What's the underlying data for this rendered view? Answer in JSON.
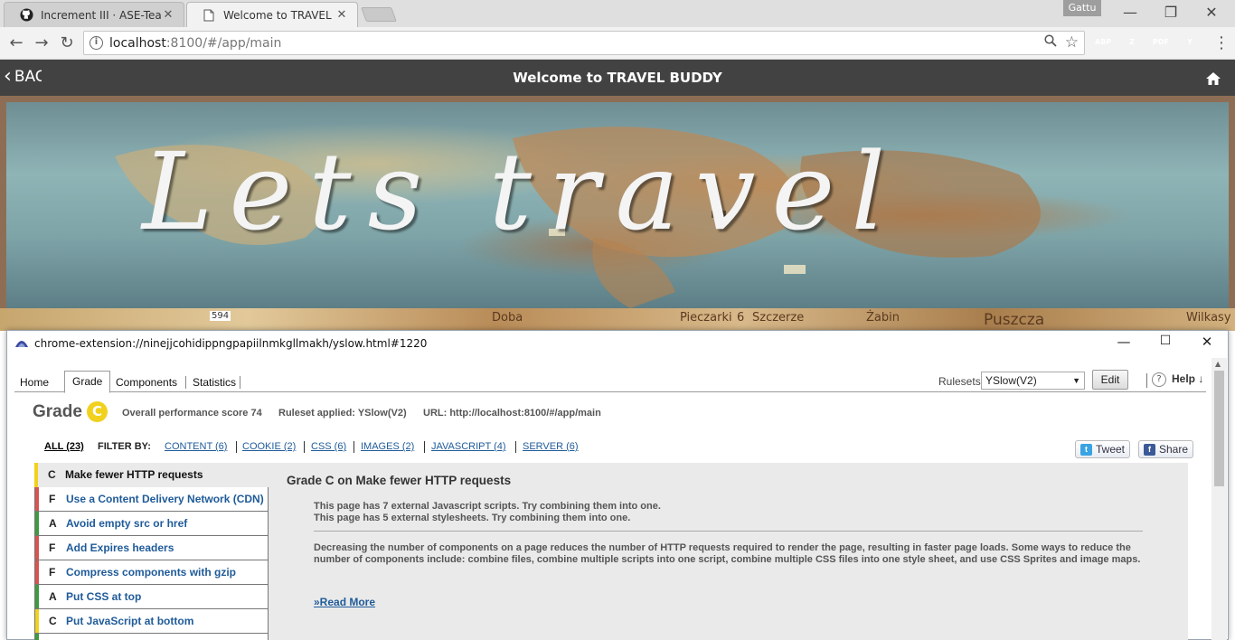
{
  "browser": {
    "tabs": [
      {
        "title": "Increment III · ASE-Team",
        "icon": "github-icon"
      },
      {
        "title": "Welcome to TRAVEL BUD",
        "icon": "page-icon"
      }
    ],
    "profile": "Gattu",
    "url_host": "localhost",
    "url_path": ":8100/#/app/main",
    "extensions": [
      {
        "name": "adblock-plus-icon",
        "label": "ABP",
        "color": "#c70d0d"
      },
      {
        "name": "zotero-icon",
        "label": "Z",
        "color": "#2a5db0"
      },
      {
        "name": "acrobat-icon",
        "label": "PDF",
        "color": "#b30b00"
      },
      {
        "name": "yslow-icon",
        "label": "Y",
        "color": "#3b4aa0"
      }
    ]
  },
  "app": {
    "back_label": "BACK",
    "title": "Welcome to TRAVEL BUDDY",
    "banner_text": "Lets travel",
    "map_labels": [
      "594",
      "Doba",
      "Pieczarki",
      "6",
      "Szczerze",
      "Żabin",
      "Puszcza",
      "Wilkasy"
    ]
  },
  "yslow": {
    "window_title": "chrome-extension://ninejjcohidippngpapiilnmkgllmakh/yslow.html#1220",
    "tabs": [
      "Home",
      "Grade",
      "Components",
      "Statistics"
    ],
    "active_tab": "Grade",
    "rulesets_label": "Rulesets",
    "ruleset_value": "YSlow(V2)",
    "edit_label": "Edit",
    "help_label": "Help ↓",
    "grade_label": "Grade",
    "grade_value": "C",
    "grade_color": "#f1d11d",
    "overall_score": "Overall performance score 74",
    "ruleset_applied": "Ruleset applied: YSlow(V2)",
    "url_info": "URL: http://localhost:8100/#/app/main",
    "filter_all": "ALL (23)",
    "filter_by": "FILTER BY:",
    "filters": [
      "CONTENT (6)",
      "COOKIE (2)",
      "CSS (6)",
      "IMAGES (2)",
      "JAVASCRIPT (4)",
      "SERVER (6)"
    ],
    "tweet_label": "Tweet",
    "share_label": "Share",
    "rules": [
      {
        "grade": "C",
        "name": "Make fewer HTTP requests",
        "color": "#f1d11d"
      },
      {
        "grade": "F",
        "name": "Use a Content Delivery Network (CDN)",
        "color": "#d9534f"
      },
      {
        "grade": "A",
        "name": "Avoid empty src or href",
        "color": "#3e9a3e"
      },
      {
        "grade": "F",
        "name": "Add Expires headers",
        "color": "#d9534f"
      },
      {
        "grade": "F",
        "name": "Compress components with gzip",
        "color": "#d9534f"
      },
      {
        "grade": "A",
        "name": "Put CSS at top",
        "color": "#3e9a3e"
      },
      {
        "grade": "C",
        "name": "Put JavaScript at bottom",
        "color": "#f1d11d"
      }
    ],
    "detail": {
      "heading": "Grade C on Make fewer HTTP requests",
      "issues": [
        "This page has 7 external Javascript scripts. Try combining them into one.",
        "This page has 5 external stylesheets. Try combining them into one."
      ],
      "description": "Decreasing the number of components on a page reduces the number of HTTP requests required to render the page, resulting in faster page loads. Some ways to reduce the number of components include: combine files, combine multiple scripts into one script, combine multiple CSS files into one style sheet, and use CSS Sprites and image maps.",
      "read_more": "»Read More"
    }
  }
}
